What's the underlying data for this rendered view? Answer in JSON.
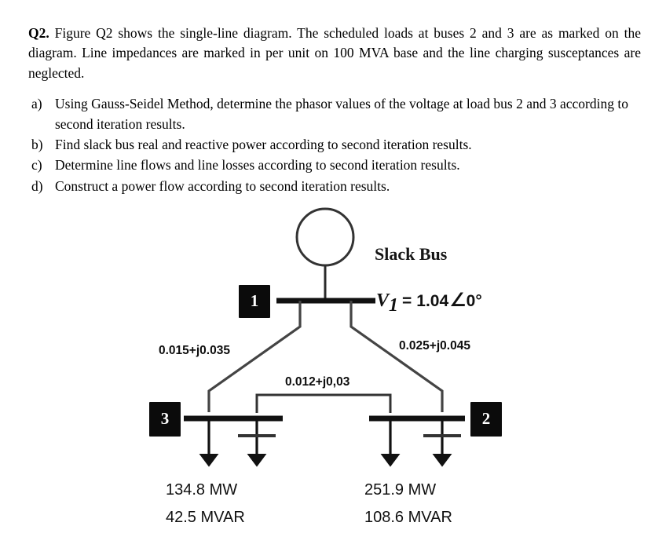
{
  "question": {
    "label": "Q2.",
    "intro": "Figure Q2 shows the single-line diagram. The scheduled loads at buses 2 and 3 are as marked on the diagram. Line impedances are marked in per unit on 100 MVA base and the line charging susceptances are neglected.",
    "items": [
      {
        "marker": "a)",
        "text": "Using Gauss-Seidel Method, determine the phasor values of the voltage at load bus 2 and 3 according to second iteration results."
      },
      {
        "marker": "b)",
        "text": "Find slack bus real and reactive power according to second iteration results."
      },
      {
        "marker": "c)",
        "text": "Determine line flows and line losses according to second iteration results."
      },
      {
        "marker": "d)",
        "text": "Construct a power flow according to second iteration results."
      }
    ]
  },
  "diagram": {
    "buses": {
      "bus1": {
        "number": "1",
        "role": "Slack Bus"
      },
      "bus2": {
        "number": "2"
      },
      "bus3": {
        "number": "3"
      }
    },
    "slack": {
      "title": "Slack Bus",
      "voltage_symbol": "V",
      "voltage_subscript": "1",
      "voltage_equals": "=",
      "voltage_magnitude": "1.04",
      "voltage_angle_symbol": "∠",
      "voltage_angle": "0°",
      "voltage_full": "V₁ = 1.04∠0°"
    },
    "line_impedances": {
      "line_1_3": "0.015+j0.035",
      "line_1_2": "0.025+j0.045",
      "line_3_2": "0.012+j0,03"
    },
    "loads": {
      "bus3": {
        "real_power": "134.8 MW",
        "reactive_power": "42.5 MVAR"
      },
      "bus2": {
        "real_power": "251.9 MW",
        "reactive_power": "108.6 MVAR"
      }
    },
    "generator": {
      "symbol": "generator-circle",
      "attached_bus": "1"
    }
  },
  "colors": {
    "bus_box_fill": "#0b0b0b",
    "bus_box_text": "#ffffff",
    "busbar": "#111111",
    "line": "#444444",
    "text": "#111111",
    "background": "#ffffff"
  }
}
